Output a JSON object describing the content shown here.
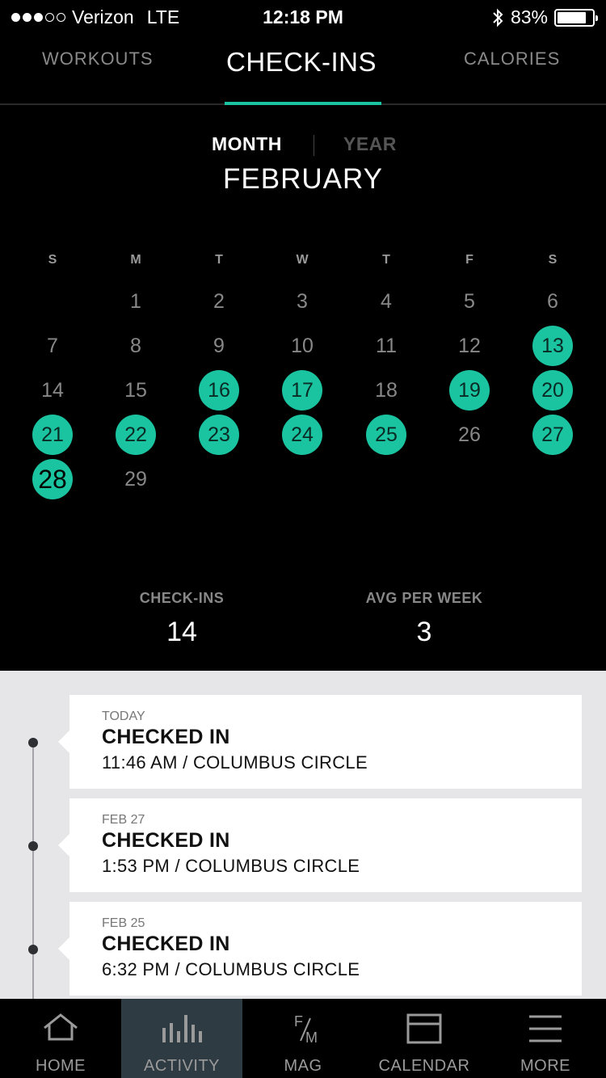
{
  "status_bar": {
    "carrier": "Verizon",
    "network": "LTE",
    "time": "12:18 PM",
    "battery_text": "83%",
    "battery_level": 0.83
  },
  "tabs": {
    "workouts": "WORKOUTS",
    "checkins": "CHECK-INS",
    "calories": "CALORIES"
  },
  "period": {
    "month": "MONTH",
    "year": "YEAR"
  },
  "calendar": {
    "month_name": "FEBRUARY",
    "weekdays": [
      "S",
      "M",
      "T",
      "W",
      "T",
      "F",
      "S"
    ],
    "first_weekday_index": 1,
    "days_in_month": 29,
    "checked_in_days": [
      13,
      16,
      17,
      19,
      20,
      21,
      22,
      23,
      24,
      25,
      27,
      28
    ],
    "today": 28
  },
  "stats": {
    "checkins_label": "CHECK-INS",
    "checkins_value": "14",
    "avg_label": "AVG PER WEEK",
    "avg_value": "3"
  },
  "feed": [
    {
      "date": "TODAY",
      "title": "CHECKED IN",
      "detail": "11:46 AM / COLUMBUS CIRCLE"
    },
    {
      "date": "FEB 27",
      "title": "CHECKED IN",
      "detail": "1:53 PM / COLUMBUS CIRCLE"
    },
    {
      "date": "FEB 25",
      "title": "CHECKED IN",
      "detail": "6:32 PM / COLUMBUS CIRCLE"
    }
  ],
  "nav": {
    "home": "HOME",
    "activity": "ACTIVITY",
    "mag": "MAG",
    "mag_icon_top": "F",
    "mag_icon_bottom": "M",
    "calendar": "CALENDAR",
    "more": "MORE"
  },
  "colors": {
    "accent": "#1ac4a1",
    "nav_active": "#2f3b42"
  },
  "icons": {
    "home": "house-icon",
    "activity": "bar-chart-icon",
    "mag": "magazine-icon",
    "calendar": "calendar-icon",
    "more": "hamburger-menu-icon"
  }
}
